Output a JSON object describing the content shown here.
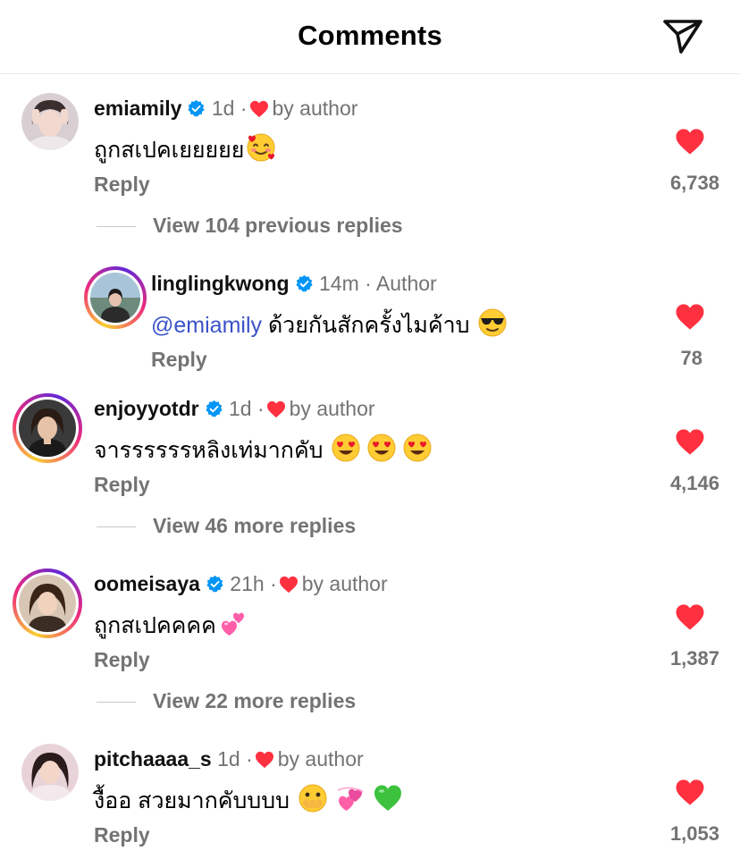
{
  "header": {
    "title": "Comments"
  },
  "comments": [
    {
      "username": "emiamily",
      "time": "1d",
      "dot": "·",
      "liked_by": "by author",
      "text": "ถูกสเปคเยยยยย",
      "reply": "Reply",
      "likes": "6,738",
      "view_replies": "View 104 previous replies",
      "reply_item": {
        "username": "linglingkwong",
        "time": "14m",
        "dot": "·",
        "tag": "Author",
        "mention": "@emiamily",
        "text": " ด้วยกันสักครั้งไมค้าบ ",
        "reply": "Reply",
        "likes": "78"
      }
    },
    {
      "username": "enjoyyotdr",
      "time": "1d",
      "dot": "·",
      "liked_by": "by author",
      "text": "จารรรรรรหลิงเท่มากคับ ",
      "reply": "Reply",
      "likes": "4,146",
      "view_replies": "View 46 more replies"
    },
    {
      "username": "oomeisaya",
      "time": "21h",
      "dot": "·",
      "liked_by": "by author",
      "text": "ถูกสเปคคคค",
      "reply": "Reply",
      "likes": "1,387",
      "view_replies": "View 22 more replies"
    },
    {
      "username": "pitchaaaa_s",
      "time": "1d",
      "dot": "·",
      "liked_by": "by author",
      "text": "งื้ออ สวยมากคับบบบ ",
      "reply": "Reply",
      "likes": "1,053"
    }
  ],
  "colors": {
    "like_red": "#ff3040",
    "verified_blue": "#0095f6",
    "secondary_text": "#737373",
    "mention_blue": "#3a52c9"
  }
}
